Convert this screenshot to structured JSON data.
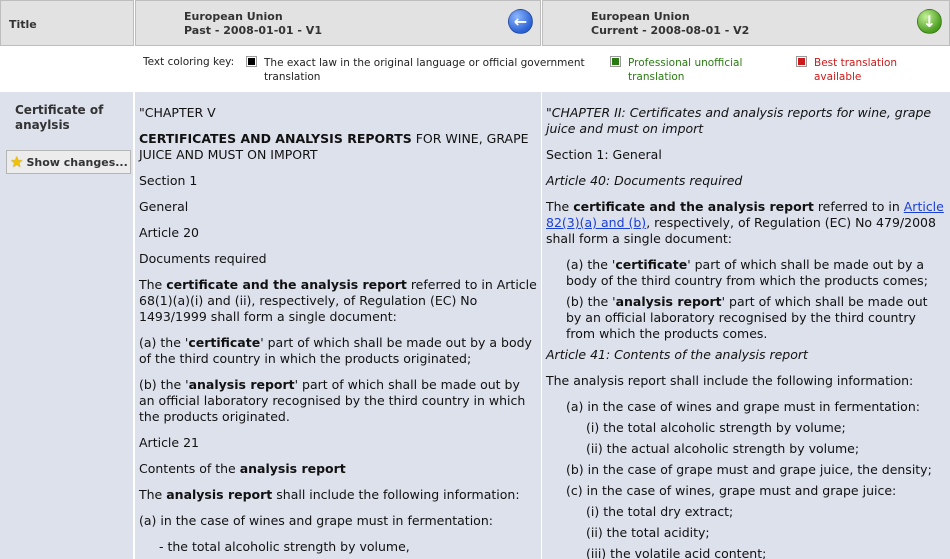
{
  "header": {
    "title_label": "Title",
    "v1": {
      "line1": "European Union",
      "line2": "Past - 2008-01-01 - V1"
    },
    "v2": {
      "line1": "European Union",
      "line2": "Current - 2008-08-01 - V2"
    }
  },
  "key": {
    "label": "Text coloring key:",
    "black": "The exact law in the original language or official government translation",
    "green": "Professional unofficial translation",
    "red": "Best translation available",
    "colors": {
      "black": "#000000",
      "green": "#2a7a12",
      "red": "#cc1a1a"
    }
  },
  "sidebar": {
    "title": "Certificate of anaylsis",
    "show_changes": "Show changes..."
  },
  "v1": {
    "p1": "\"CHAPTER V",
    "p2_bold": "CERTIFICATES AND ANALYSIS REPORTS",
    "p2_rest": " FOR WINE, GRAPE JUICE AND MUST ON IMPORT",
    "p3": "Section 1",
    "p4": "General",
    "p5": "Article 20",
    "p6": "Documents required",
    "p7_a": "The ",
    "p7_b": "certificate and the analysis report",
    "p7_c": " referred to in Article 68(1)(a)(i) and (ii), respectively, of Regulation (EC) No 1493/1999 shall form a single document:",
    "p8_a": "(a) the '",
    "p8_b": "certificate",
    "p8_c": "' part of which shall be made out by a body of the third country in which the products originated;",
    "p9_a": "(b) the '",
    "p9_b": "analysis report",
    "p9_c": "' part of which shall be made out by an official laboratory recognised by the third country in which the products originated.",
    "p10": "Article 21",
    "p11_a": "Contents of the ",
    "p11_b": "analysis report",
    "p12_a": "The ",
    "p12_b": "analysis report",
    "p12_c": " shall include the following information:",
    "p13": "(a) in the case of wines and grape must in fermentation:",
    "p14": "- the total alcoholic strength by volume,"
  },
  "v2": {
    "p1": "\"CHAPTER II: Certificates and analysis reports for wine, grape juice and must on import",
    "p2": "Section 1: General",
    "p3": "Article 40: Documents required",
    "p4_a": "The ",
    "p4_b": "certificate and the analysis report",
    "p4_c": " referred to in ",
    "p4_link": "Article 82(3)(a) and (b)",
    "p4_d": ", respectively, of Regulation (EC) No 479/2008 shall form a single document:",
    "p5_a": "(a) the '",
    "p5_b": "certificate",
    "p5_c": "' part of which shall be made out by a body of the third country from which the products comes;",
    "p6_a": "(b) the '",
    "p6_b": "analysis report",
    "p6_c": "' part of which shall be made out by an official laboratory recognised by the third country from which the products comes.",
    "p7": "Article 41: Contents of the analysis report",
    "p8": "The analysis report shall include the following information:",
    "p9": "(a) in the case of wines and grape must in fermentation:",
    "p10": "(i) the total alcoholic strength by volume;",
    "p11": "(ii) the actual alcoholic strength by volume;",
    "p12": "(b) in the case of grape must and grape juice, the density;",
    "p13": "(c) in the case of wines, grape must and grape juice:",
    "p14": "(i) the total dry extract;",
    "p15": "(ii) the total acidity;",
    "p16": "(iii) the volatile acid content;"
  }
}
